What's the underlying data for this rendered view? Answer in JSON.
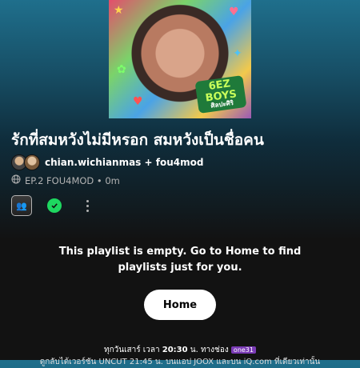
{
  "cover": {
    "badge_line1": "6EZ",
    "badge_line2": "BOYS",
    "badge_line3": "ศิลปะศิริ"
  },
  "playlist": {
    "title": "รักที่สมหวังไม่มีหรอก สมหวังเป็นชื่อคน",
    "owners": "chian.wichianmas + fou4mod",
    "meta": "EP.2 FOU4MOD • 0m"
  },
  "empty_state": {
    "line1": "This playlist is empty. Go to Home to find",
    "line2": "playlists just for you.",
    "button_label": "Home"
  },
  "caption": {
    "schedule_prefix": "ทุกวันเสาร์ เวลา ",
    "time": "20:30",
    "schedule_suffix": " น. ทางช่อง ",
    "channel": "one31",
    "line2": "ดูกลับได้เวอร์ชัน UNCUT 21:45 น. บนแอป JOOX และบน iQ.com ที่เดียวเท่านั้น"
  },
  "colors": {
    "accent_green": "#1ed760",
    "header_teal": "#1f6f8c",
    "background": "#121212"
  },
  "icons": {
    "globe": "globe-icon",
    "check": "check-circle-icon",
    "more": "more-vertical-icon"
  }
}
